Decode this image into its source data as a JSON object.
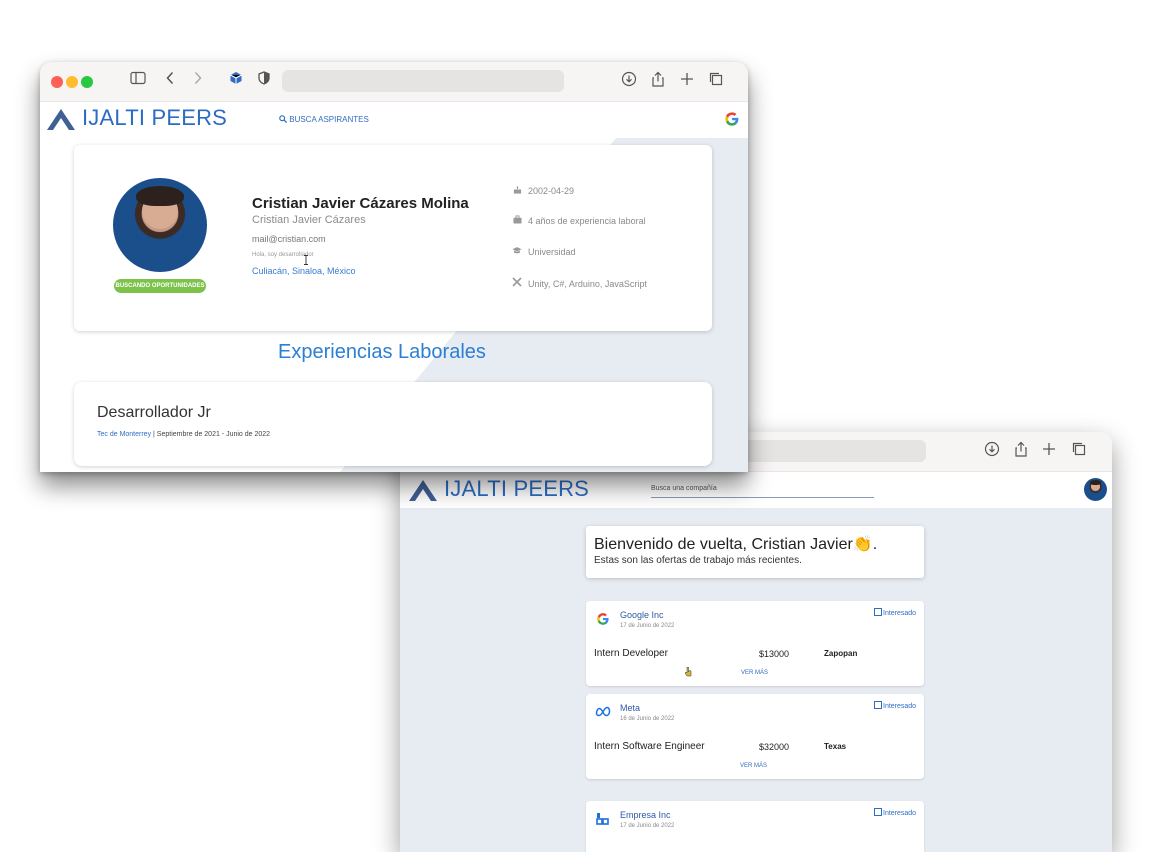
{
  "brand": {
    "name": "IJALTI PEERS",
    "color": "#2b6cc4"
  },
  "back_window": {
    "nav": {
      "search_link": "BUSCA ASPIRANTES",
      "search_icon": "search-icon",
      "google_icon": "google-icon"
    },
    "profile": {
      "full_name": "Cristian Javier Cázares Molina",
      "alias": "Cristian Javier Cázares",
      "email": "mail@cristian.com",
      "bio": "Hola, soy desarrollador",
      "location": "Culiacán, Sinaloa, México",
      "status_badge": "BUSCANDO OPORTUNIDADES",
      "details": [
        {
          "icon": "cake-icon",
          "text": "2002-04-29"
        },
        {
          "icon": "briefcase-icon",
          "text": "4 años de experiencia laboral"
        },
        {
          "icon": "graduation-cap-icon",
          "text": "Universidad"
        },
        {
          "icon": "tools-icon",
          "text": "Unity, C#, Arduino, JavaScript"
        }
      ]
    },
    "experience_section_title": "Experiencias Laborales",
    "experience": [
      {
        "title": "Desarrollador Jr",
        "company": "Tec de Monterrey",
        "period": "| Septiembre de 2021 - Junio de 2022"
      }
    ]
  },
  "front_window": {
    "search_placeholder": "Busca una compañía",
    "welcome_title": "Bienvenido de vuelta, Cristian Javier",
    "welcome_emoji": "👏",
    "welcome_period": ".",
    "welcome_sub": "Estas son las ofertas de trabajo más recientes.",
    "offers": [
      {
        "company": "Google Inc",
        "date": "17 de Junio de 2022",
        "role": "Intern Developer",
        "salary": "$13000",
        "city": "Zapopan",
        "more": "VER MÁS",
        "interest": "Interesado",
        "logo": "google-logo-icon"
      },
      {
        "company": "Meta",
        "date": "16 de Junio de 2022",
        "role": "Intern Software Engineer",
        "salary": "$32000",
        "city": "Texas",
        "more": "VER MÁS",
        "interest": "Interesado",
        "logo": "meta-logo-icon"
      },
      {
        "company": "Empresa Inc",
        "date": "17 de Junio de 2022",
        "interest": "Interesado",
        "logo": "empresa-logo-icon"
      }
    ]
  },
  "colors": {
    "accent": "#2b6cc4",
    "badge": "#7dc24b",
    "panel": "#e7ebf2"
  }
}
